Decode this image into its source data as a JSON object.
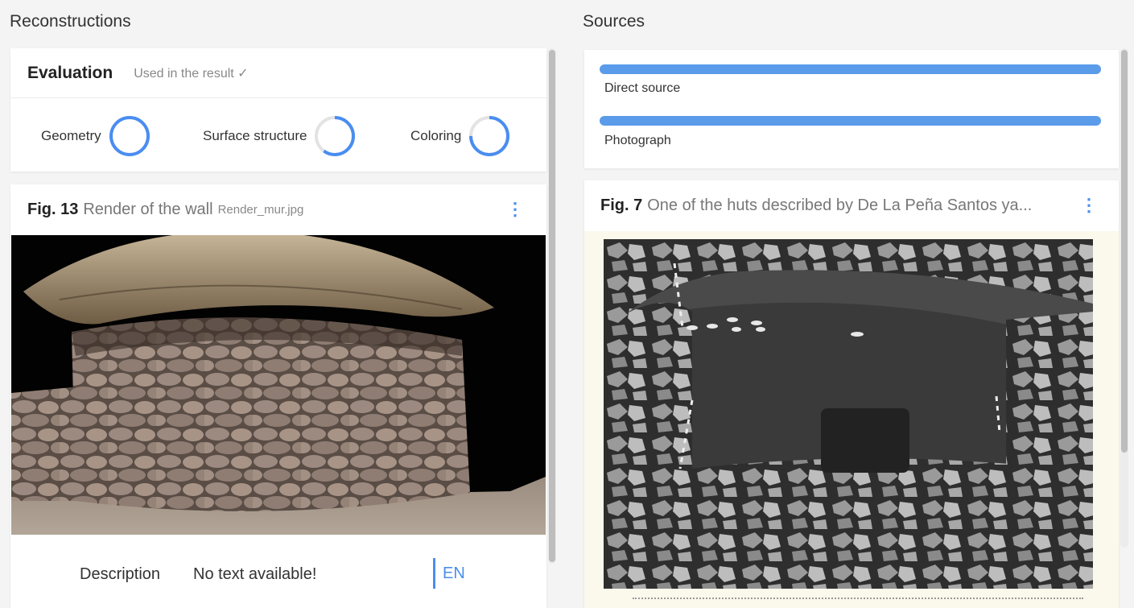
{
  "reconstructions": {
    "title": "Reconstructions",
    "evaluation": {
      "title": "Evaluation",
      "used_label": "Used in the result ✓",
      "metrics": [
        {
          "label": "Geometry",
          "level": 1.0
        },
        {
          "label": "Surface structure",
          "level": 0.6
        },
        {
          "label": "Coloring",
          "level": 0.75
        }
      ]
    },
    "figure": {
      "number": "Fig. 13",
      "title": "Render of the wall",
      "filename": "Render_mur.jpg",
      "menu_icon": "kebab-menu-icon"
    },
    "description": {
      "label": "Description",
      "text": "No text available!",
      "language": "EN"
    }
  },
  "sources": {
    "title": "Sources",
    "items": [
      {
        "label": "Direct source",
        "level": 1.0
      },
      {
        "label": "Photograph",
        "level": 1.0
      }
    ],
    "figure": {
      "number": "Fig. 7",
      "title": "One of the huts described by De La Peña Santos ya...",
      "menu_icon": "kebab-menu-icon"
    }
  },
  "colors": {
    "accent": "#4a8df0",
    "bar": "#5a9bea",
    "panel_bg": "#f4f4f4"
  }
}
